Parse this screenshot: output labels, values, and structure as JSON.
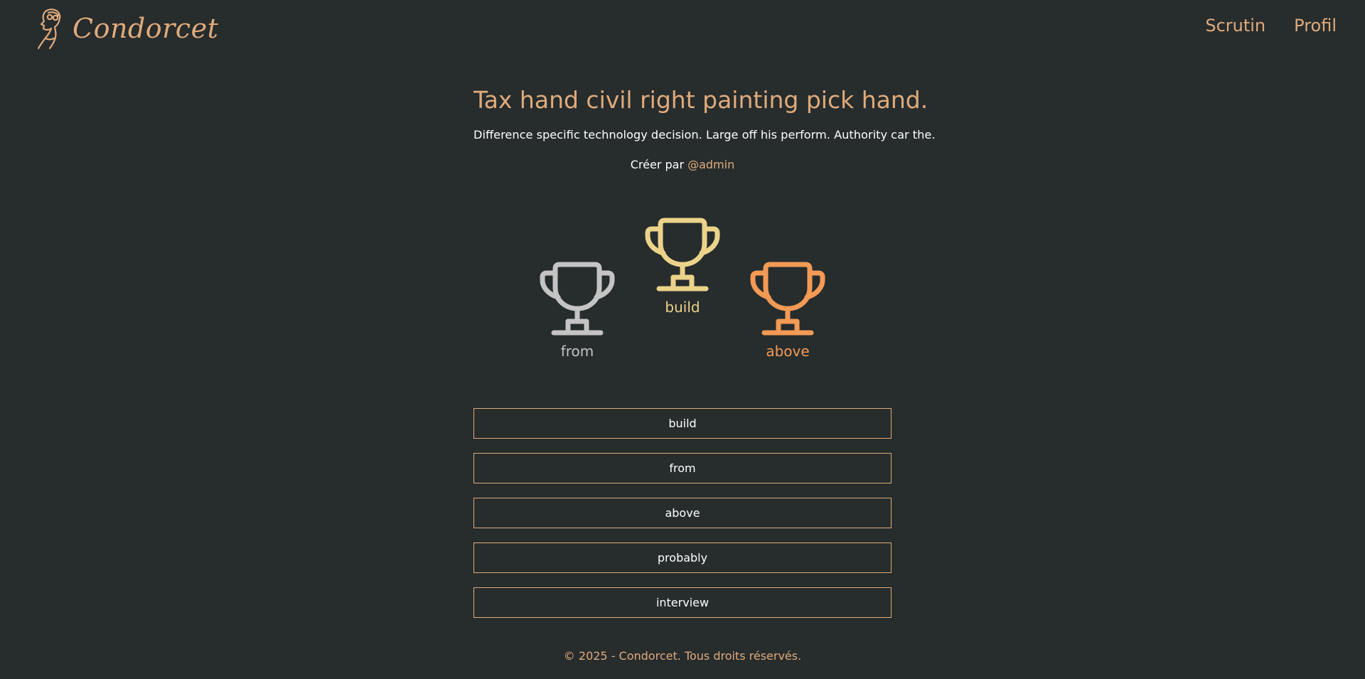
{
  "header": {
    "brand_name": "Condorcet",
    "nav": [
      {
        "label": "Scrutin"
      },
      {
        "label": "Profil"
      }
    ]
  },
  "poll": {
    "title": "Tax hand civil right painting pick hand.",
    "description": "Difference specific technology decision. Large off his perform. Authority car the.",
    "creator_prefix": "Créer par",
    "creator_user": "@admin"
  },
  "podium": {
    "first": {
      "label": "build",
      "color": "#ecd38a"
    },
    "second": {
      "label": "from",
      "color": "#c4c4c4"
    },
    "third": {
      "label": "above",
      "color": "#f39a55"
    }
  },
  "options": [
    {
      "label": "build"
    },
    {
      "label": "from"
    },
    {
      "label": "above"
    },
    {
      "label": "probably"
    },
    {
      "label": "interview"
    }
  ],
  "footer": {
    "text": "© 2025 - Condorcet. Tous droits réservés."
  },
  "colors": {
    "background": "#272c2d",
    "accent": "#e0ab7b"
  }
}
